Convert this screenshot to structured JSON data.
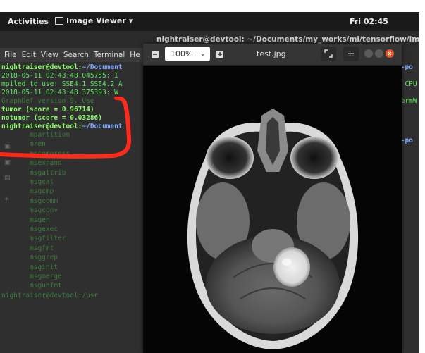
{
  "topbar": {
    "activities": "Activities",
    "app_menu": "Image Viewer",
    "clock": "Fri 02:45"
  },
  "terminal": {
    "title": "nightraiser@devtool: ~/Documents/my_works/ml/tensorflow/image_cl",
    "menu": [
      "File",
      "Edit",
      "View",
      "Search",
      "Terminal",
      "He"
    ],
    "lines": {
      "l1a": "nightraiser@devtool:",
      "l1b": "~/Document",
      "l2": "2018-05-11 02:43:48.045755: I",
      "l3": "mpiled to use: SSE4.1 SSE4.2 A",
      "l4": "2018-05-11 02:43:48.375393: W",
      "l5": "  GraphDef version 9. Use",
      "l6": "tumor (score = 0.96714)",
      "l7": "notumor (score = 0.03286)",
      "l8a": "nightraiser@devtool:",
      "l8b": "~/Document",
      "cmds": [
        "mpartition",
        "mren",
        "mscompress",
        "msexpand",
        "msgattrib",
        "msgcat",
        "msgcmp",
        "msgcomm",
        "msgconv",
        "msgen",
        "msgexec",
        "msgfilter",
        "msgfmt",
        "msggrep",
        "msginit",
        "msgmerge",
        "msgunfmt"
      ],
      "l_last_a": "nightraiser@devtool:",
      "l_last_b": "/usr"
    },
    "right_fragments": [
      "r-po",
      "r CPU",
      "NormW",
      "r-po"
    ]
  },
  "viewer": {
    "zoom": "100%",
    "file_title": "test.jpg"
  },
  "colors": {
    "annotation": "#ff2a1a",
    "terminal_green": "#5fe85f",
    "path_blue": "#7aa7ff"
  }
}
